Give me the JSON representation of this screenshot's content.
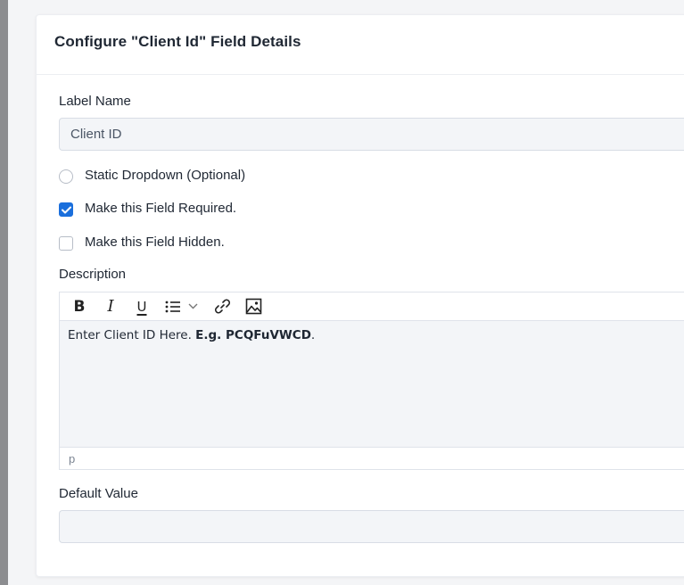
{
  "panel": {
    "title": "Configure \"Client Id\" Field Details"
  },
  "label_name": {
    "label": "Label Name",
    "value": "Client ID"
  },
  "options": {
    "static_dropdown": {
      "label": "Static Dropdown (Optional)",
      "selected": false
    },
    "required": {
      "label": "Make this Field Required.",
      "checked": true
    },
    "hidden": {
      "label": "Make this Field Hidden.",
      "checked": false
    }
  },
  "description": {
    "label": "Description",
    "toolbar": {
      "bold": "B",
      "italic": "I",
      "underline": "U"
    },
    "content_plain": "Enter Client ID Here. ",
    "content_bold": "E.g. PCQFuVWCD",
    "content_tail": ".",
    "status_path": "p"
  },
  "default_value": {
    "label": "Default Value",
    "value": ""
  },
  "colors": {
    "accent": "#1a6fdc",
    "input_bg": "#f3f5f8",
    "rail": "#8c8d90"
  }
}
